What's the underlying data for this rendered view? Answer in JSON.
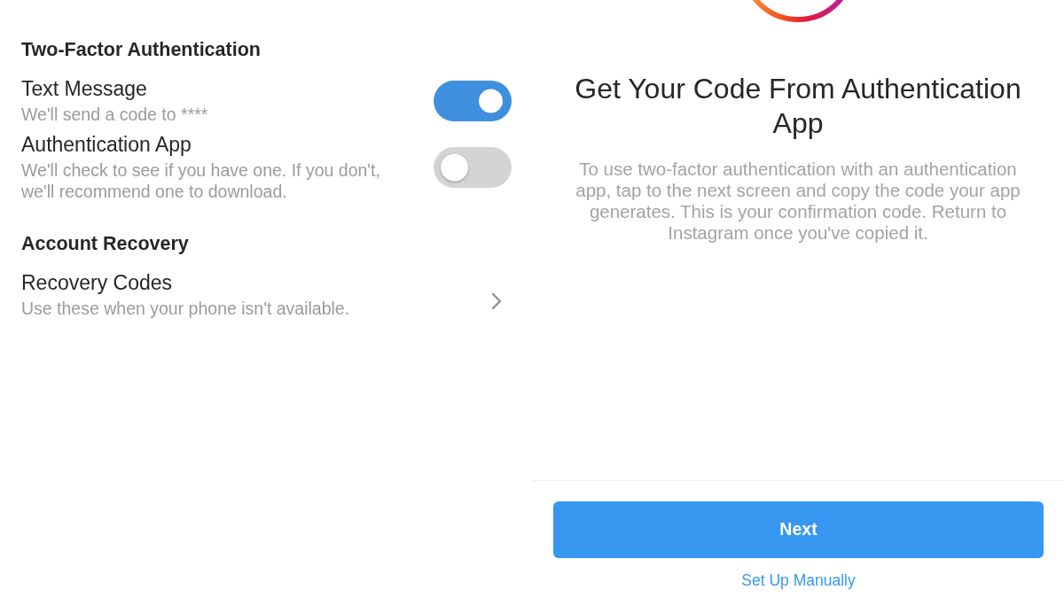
{
  "settings": {
    "sections": [
      {
        "title": "Two-Factor Authentication",
        "items": [
          {
            "kind": "toggle",
            "label": "Text Message",
            "description": "We'll send a code to ****",
            "on": true
          },
          {
            "kind": "toggle",
            "label": "Authentication App",
            "description": "We'll check to see if you have one. If you don't, we'll recommend one to download.",
            "on": false
          }
        ]
      },
      {
        "title": "Account Recovery",
        "items": [
          {
            "kind": "link",
            "label": "Recovery Codes",
            "description": "Use these when your phone isn't available."
          }
        ]
      }
    ]
  },
  "auth_app_screen": {
    "title": "Get Your Code From Authentication App",
    "body": "To use two-factor authentication with an authentication app, tap to the next screen and copy the code your app generates. This is your confirmation code. Return to Instagram once you've copied it.",
    "primary_button": "Next",
    "secondary_link": "Set Up Manually"
  }
}
